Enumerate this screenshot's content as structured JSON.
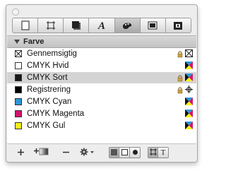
{
  "panel": {
    "section_title": "Farve",
    "tabs": [
      "fill-icon",
      "frame-icon",
      "shadow-icon",
      "character-icon",
      "color-palette-icon",
      "image-icon",
      "lock-icon"
    ],
    "active_tab": "color-palette-icon"
  },
  "colors": [
    {
      "name": "Gennemsigtig",
      "swatch": "transparent",
      "locked": true,
      "model": "none"
    },
    {
      "name": "CMYK Hvid",
      "swatch": "#ffffff",
      "locked": false,
      "model": "cmyk"
    },
    {
      "name": "CMYK Sort",
      "swatch": "#1a1a1a",
      "locked": true,
      "model": "cmyk",
      "selected": true
    },
    {
      "name": "Registrering",
      "swatch": "#000000",
      "locked": true,
      "model": "registration"
    },
    {
      "name": "CMYK Cyan",
      "swatch": "#2e95d3",
      "locked": false,
      "model": "cmyk"
    },
    {
      "name": "CMYK Magenta",
      "swatch": "#d4136e",
      "locked": false,
      "model": "cmyk"
    },
    {
      "name": "CMYK Gul",
      "swatch": "#f7ee1b",
      "locked": false,
      "model": "cmyk"
    }
  ],
  "footer": {
    "icons": [
      "add-icon",
      "add-gradient-icon",
      "remove-icon",
      "gear-menu-icon",
      "solid-fill-icon",
      "no-fill-icon",
      "radial-fill-icon",
      "frame-target-icon",
      "text-target-icon"
    ],
    "text_target_label": "T"
  }
}
